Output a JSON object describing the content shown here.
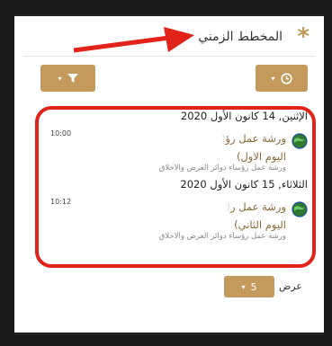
{
  "block": {
    "title": "المخطط الزمني",
    "star": "*"
  },
  "filters": {
    "filter_caret": "▾",
    "clock_caret": "▾"
  },
  "days": [
    {
      "heading": "الإثنين, 14 كانون الأول 2020",
      "event": {
        "name_line1": "ورشة عمل رؤ",
        "name_line2": "اليوم الاول)",
        "time": "10:00",
        "course": "ورشة عمل رؤساء دوائر العرض والاخلاق"
      }
    },
    {
      "heading": "الثلاثاء, 15 كانون الأول 2020",
      "event": {
        "name_line1": "ورشة عمل ر",
        "name_line2": "اليوم الثاني)",
        "time": "10:12",
        "course": "ورشة عمل رؤساء دوائر العرض والاخلاق"
      }
    }
  ],
  "footer": {
    "show_label": "عرض",
    "count": "5",
    "count_caret": "▾"
  },
  "colors": {
    "accent": "#c49a5c",
    "highlight": "#e2231a",
    "arrow": "#e2231a"
  }
}
